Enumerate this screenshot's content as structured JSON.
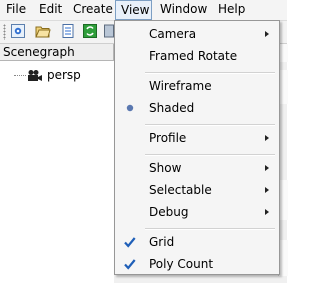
{
  "menubar": {
    "items": [
      {
        "label": "File"
      },
      {
        "label": "Edit"
      },
      {
        "label": "Create"
      },
      {
        "label": "View"
      },
      {
        "label": "Window"
      },
      {
        "label": "Help"
      }
    ]
  },
  "scenegraph": {
    "title": "Scenegraph",
    "nodes": [
      {
        "label": "persp",
        "icon": "camera-icon"
      }
    ]
  },
  "view_menu": {
    "items": [
      {
        "label": "Camera",
        "submenu": true
      },
      {
        "label": "Framed Rotate"
      },
      {
        "label": "Wireframe"
      },
      {
        "label": "Shaded",
        "selected": true
      },
      {
        "label": "Profile",
        "submenu": true
      },
      {
        "label": "Show",
        "submenu": true
      },
      {
        "label": "Selectable",
        "submenu": true
      },
      {
        "label": "Debug",
        "submenu": true
      },
      {
        "label": "Grid",
        "checked": true
      },
      {
        "label": "Poly Count",
        "checked": true
      }
    ]
  },
  "colors": {
    "menu_active_border": "#7d9fc4",
    "check_color": "#1f5fb8",
    "radio_color": "#5a78b0"
  }
}
